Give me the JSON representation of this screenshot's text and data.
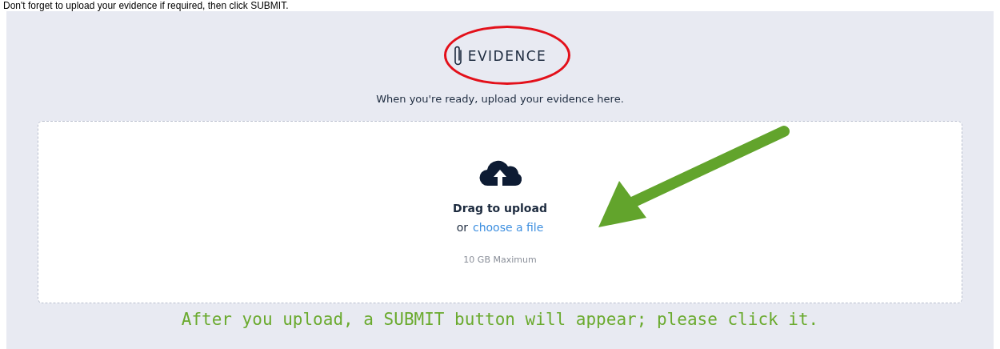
{
  "instruction": "Don't forget to upload your evidence if required, then click SUBMIT.",
  "panel": {
    "title": "EVIDENCE",
    "subtitle": "When you're ready, upload your evidence here.",
    "dropzone": {
      "heading": "Drag to upload",
      "or_text": "or",
      "link": "choose a file",
      "limit": "10 GB Maximum"
    }
  },
  "note": "After you upload, a SUBMIT button will appear; please click it."
}
